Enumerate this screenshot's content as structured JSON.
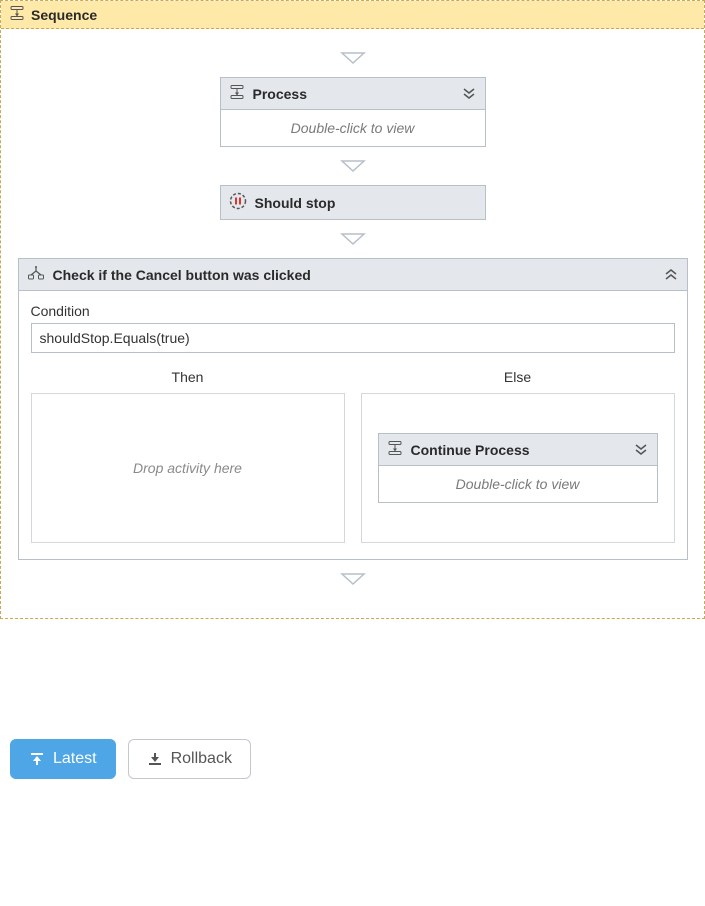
{
  "sequence": {
    "title": "Sequence"
  },
  "process": {
    "title": "Process",
    "body_hint": "Double-click to view"
  },
  "should_stop": {
    "title": "Should stop"
  },
  "if_block": {
    "title": "Check if the Cancel button was clicked",
    "condition_label": "Condition",
    "condition_value": "shouldStop.Equals(true)",
    "then_label": "Then",
    "else_label": "Else",
    "drop_hint": "Drop activity here"
  },
  "continue_process": {
    "title": "Continue Process",
    "body_hint": "Double-click to view"
  },
  "buttons": {
    "latest": "Latest",
    "rollback": "Rollback"
  }
}
